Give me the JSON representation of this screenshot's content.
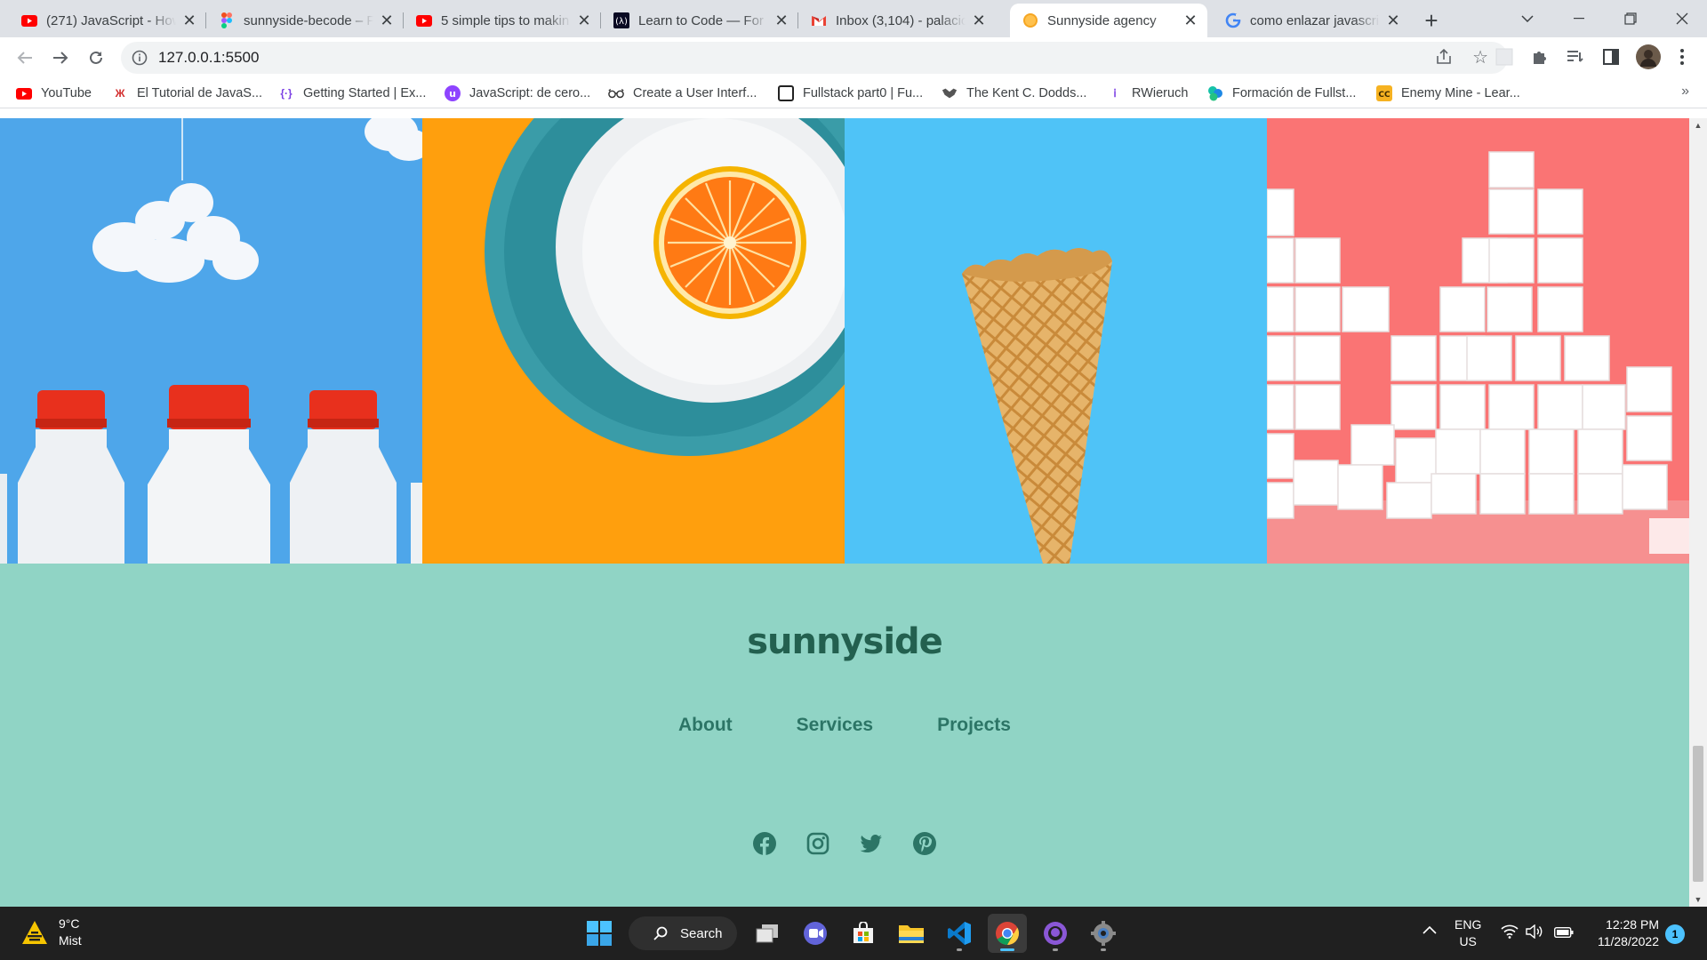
{
  "browser": {
    "tabs": [
      {
        "title": "(271) JavaScript - How",
        "favicon": "youtube-icon"
      },
      {
        "title": "sunnyside-becode – F",
        "favicon": "figma-icon"
      },
      {
        "title": "5 simple tips to makin",
        "favicon": "youtube-icon"
      },
      {
        "title": "Learn to Code — For",
        "favicon": "freecodecamp-icon"
      },
      {
        "title": "Inbox (3,104) - palacio",
        "favicon": "gmail-icon"
      },
      {
        "title": "Sunnyside agency",
        "favicon": "orange-icon",
        "active": true
      },
      {
        "title": "como enlazar javascri",
        "favicon": "google-icon"
      }
    ],
    "url": "127.0.0.1:5500",
    "bookmarks": [
      {
        "label": "YouTube",
        "icon": "youtube-icon"
      },
      {
        "label": "El Tutorial de JavaS...",
        "icon": "tutorial-icon"
      },
      {
        "label": "Getting Started | Ex...",
        "icon": "express-icon"
      },
      {
        "label": "JavaScript: de cero...",
        "icon": "javascript-course-icon"
      },
      {
        "label": "Create a User Interf...",
        "icon": "glasses-icon"
      },
      {
        "label": "Fullstack part0 | Fu...",
        "icon": "fullstack-icon"
      },
      {
        "label": "The Kent C. Dodds...",
        "icon": "kcd-icon"
      },
      {
        "label": "RWieruch",
        "icon": "rwieruch-icon"
      },
      {
        "label": "Formación de Fullst...",
        "icon": "formacion-icon"
      },
      {
        "label": "Enemy Mine - Lear...",
        "icon": "enemy-mine-icon"
      }
    ]
  },
  "page": {
    "gallery": [
      {
        "name": "milk-bottles-image",
        "bg": "#4ea6ea"
      },
      {
        "name": "orange-plate-image",
        "bg": "#ff9f0d"
      },
      {
        "name": "ice-cream-cone-image",
        "bg": "#4fc3f7"
      },
      {
        "name": "sugar-cubes-image",
        "bg": "#fa7474"
      }
    ],
    "footer": {
      "logo": "sunnyside",
      "nav": [
        "About",
        "Services",
        "Projects"
      ],
      "social": [
        "facebook-icon",
        "instagram-icon",
        "twitter-icon",
        "pinterest-icon"
      ],
      "bg": "#90d4c5",
      "text_color": "#2c7566"
    }
  },
  "taskbar": {
    "weather": {
      "temp": "9°C",
      "condition": "Mist"
    },
    "search_label": "Search",
    "language": {
      "lang": "ENG",
      "region": "US"
    },
    "time": "12:28 PM",
    "date": "11/28/2022",
    "notifications": "1"
  }
}
